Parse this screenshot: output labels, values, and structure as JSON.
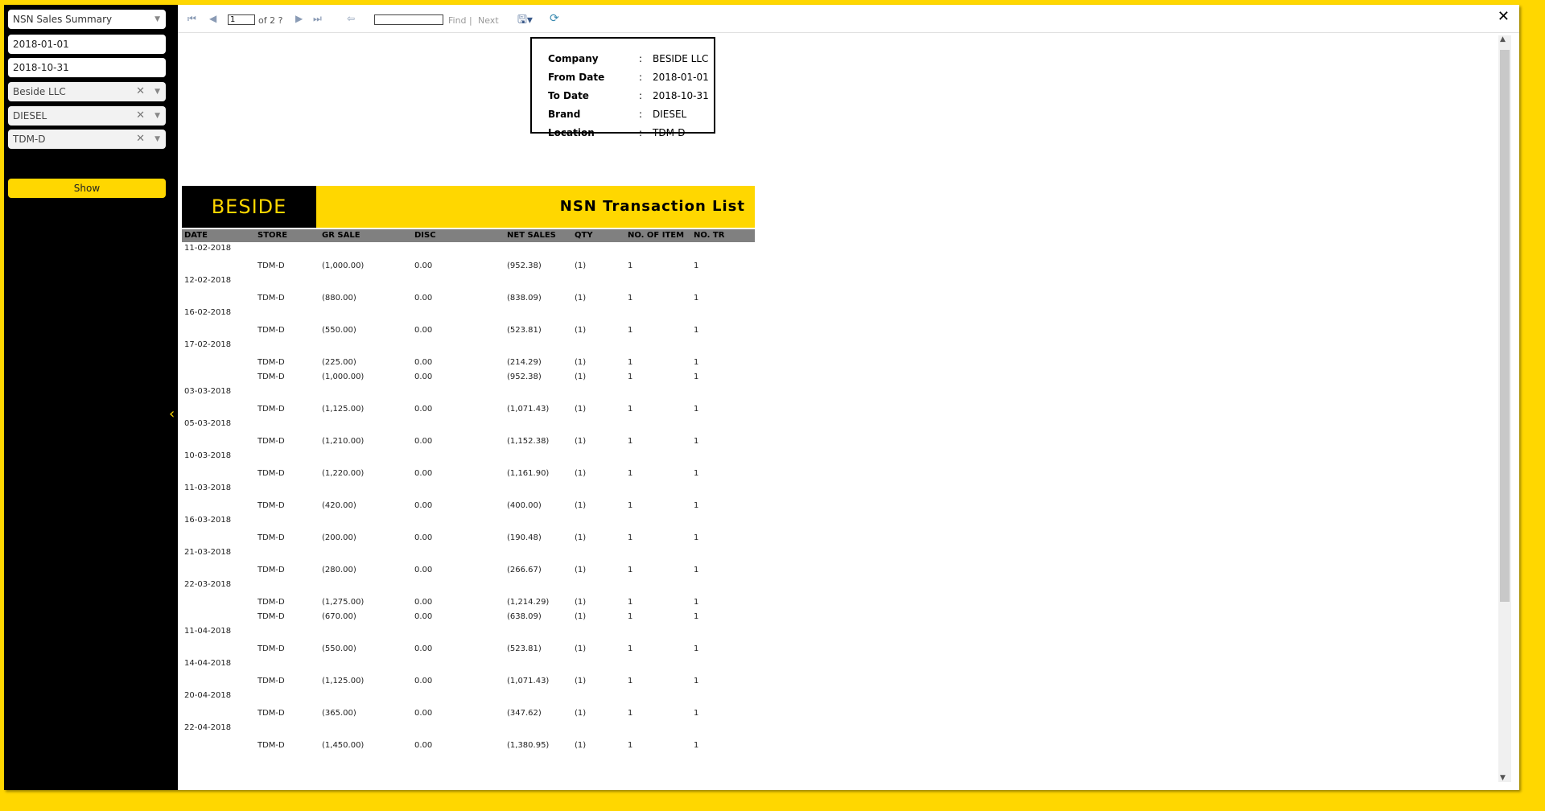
{
  "sidebar": {
    "report_select": "NSN Sales Summary",
    "from_date": "2018-01-01",
    "to_date": "2018-10-31",
    "company": "Beside LLC",
    "brand": "DIESEL",
    "location": "TDM-D",
    "show_label": "Show",
    "clear_glyph": "✕",
    "caret_glyph": "▼"
  },
  "toolbar": {
    "page_value": "1",
    "page_of": "of 2 ?",
    "find_label": "Find",
    "separator": "|",
    "next_label": "Next"
  },
  "params": [
    {
      "key": "Company",
      "value": "BESIDE LLC"
    },
    {
      "key": "From Date",
      "value": "2018-01-01"
    },
    {
      "key": "To Date",
      "value": "2018-10-31"
    },
    {
      "key": "Brand",
      "value": "DIESEL"
    },
    {
      "key": "Location",
      "value": "TDM-D"
    }
  ],
  "banner": {
    "logo": "BESIDE",
    "title": "NSN Transaction List"
  },
  "columns": [
    "DATE",
    "STORE",
    "GR SALE",
    "DISC",
    "NET SALES",
    "QTY",
    "NO. OF ITEM",
    "NO. TR"
  ],
  "groups": [
    {
      "date": "11-02-2018",
      "rows": [
        [
          "TDM-D",
          "(1,000.00)",
          "0.00",
          "(952.38)",
          "(1)",
          "1",
          "1"
        ]
      ]
    },
    {
      "date": "12-02-2018",
      "rows": [
        [
          "TDM-D",
          "(880.00)",
          "0.00",
          "(838.09)",
          "(1)",
          "1",
          "1"
        ]
      ]
    },
    {
      "date": "16-02-2018",
      "rows": [
        [
          "TDM-D",
          "(550.00)",
          "0.00",
          "(523.81)",
          "(1)",
          "1",
          "1"
        ]
      ]
    },
    {
      "date": "17-02-2018",
      "rows": [
        [
          "TDM-D",
          "(225.00)",
          "0.00",
          "(214.29)",
          "(1)",
          "1",
          "1"
        ],
        [
          "TDM-D",
          "(1,000.00)",
          "0.00",
          "(952.38)",
          "(1)",
          "1",
          "1"
        ]
      ]
    },
    {
      "date": "03-03-2018",
      "rows": [
        [
          "TDM-D",
          "(1,125.00)",
          "0.00",
          "(1,071.43)",
          "(1)",
          "1",
          "1"
        ]
      ]
    },
    {
      "date": "05-03-2018",
      "rows": [
        [
          "TDM-D",
          "(1,210.00)",
          "0.00",
          "(1,152.38)",
          "(1)",
          "1",
          "1"
        ]
      ]
    },
    {
      "date": "10-03-2018",
      "rows": [
        [
          "TDM-D",
          "(1,220.00)",
          "0.00",
          "(1,161.90)",
          "(1)",
          "1",
          "1"
        ]
      ]
    },
    {
      "date": "11-03-2018",
      "rows": [
        [
          "TDM-D",
          "(420.00)",
          "0.00",
          "(400.00)",
          "(1)",
          "1",
          "1"
        ]
      ]
    },
    {
      "date": "16-03-2018",
      "rows": [
        [
          "TDM-D",
          "(200.00)",
          "0.00",
          "(190.48)",
          "(1)",
          "1",
          "1"
        ]
      ]
    },
    {
      "date": "21-03-2018",
      "rows": [
        [
          "TDM-D",
          "(280.00)",
          "0.00",
          "(266.67)",
          "(1)",
          "1",
          "1"
        ]
      ]
    },
    {
      "date": "22-03-2018",
      "rows": [
        [
          "TDM-D",
          "(1,275.00)",
          "0.00",
          "(1,214.29)",
          "(1)",
          "1",
          "1"
        ],
        [
          "TDM-D",
          "(670.00)",
          "0.00",
          "(638.09)",
          "(1)",
          "1",
          "1"
        ]
      ]
    },
    {
      "date": "11-04-2018",
      "rows": [
        [
          "TDM-D",
          "(550.00)",
          "0.00",
          "(523.81)",
          "(1)",
          "1",
          "1"
        ]
      ]
    },
    {
      "date": "14-04-2018",
      "rows": [
        [
          "TDM-D",
          "(1,125.00)",
          "0.00",
          "(1,071.43)",
          "(1)",
          "1",
          "1"
        ]
      ]
    },
    {
      "date": "20-04-2018",
      "rows": [
        [
          "TDM-D",
          "(365.00)",
          "0.00",
          "(347.62)",
          "(1)",
          "1",
          "1"
        ]
      ]
    },
    {
      "date": "22-04-2018",
      "rows": [
        [
          "TDM-D",
          "(1,450.00)",
          "0.00",
          "(1,380.95)",
          "(1)",
          "1",
          "1"
        ]
      ]
    }
  ],
  "colors": {
    "accent": "#FFD700",
    "sidebar": "#000000",
    "header_band": "#808080"
  }
}
